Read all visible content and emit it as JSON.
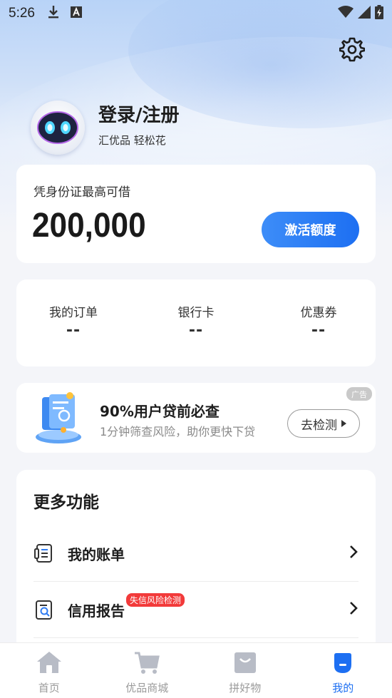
{
  "status_bar": {
    "time": "5:26",
    "left_icons": [
      "download-icon",
      "notification-a-icon"
    ],
    "right_icons": [
      "wifi-icon",
      "signal-icon",
      "battery-icon"
    ]
  },
  "header": {
    "settings_icon": "gear-icon",
    "login_title": "登录/注册",
    "login_subtitle": "汇优品 轻松花"
  },
  "credit": {
    "label": "凭身份证最高可借",
    "amount": "200,000",
    "button": "激活额度"
  },
  "orders": {
    "items": [
      {
        "label": "我的订单",
        "value": "--"
      },
      {
        "label": "银行卡",
        "value": "--"
      },
      {
        "label": "优惠券",
        "value": "--"
      }
    ]
  },
  "ad": {
    "badge": "广告",
    "title": "90%用户贷前必查",
    "subtitle": "1分钟筛查风险，助你更快下贷",
    "button": "去检测"
  },
  "more": {
    "title": "更多功能",
    "rows": [
      {
        "label": "我的账单",
        "icon": "bill-icon"
      },
      {
        "label": "信用报告",
        "icon": "credit-report-icon",
        "tag": "失信风险检测"
      }
    ]
  },
  "tabbar": {
    "tabs": [
      {
        "label": "首页",
        "icon": "home-icon"
      },
      {
        "label": "优品商城",
        "icon": "cart-icon"
      },
      {
        "label": "拼好物",
        "icon": "bag-icon"
      },
      {
        "label": "我的",
        "icon": "profile-icon",
        "active": true
      }
    ]
  },
  "colors": {
    "accent": "#1d6ff2",
    "tag_red": "#f23a3a"
  }
}
